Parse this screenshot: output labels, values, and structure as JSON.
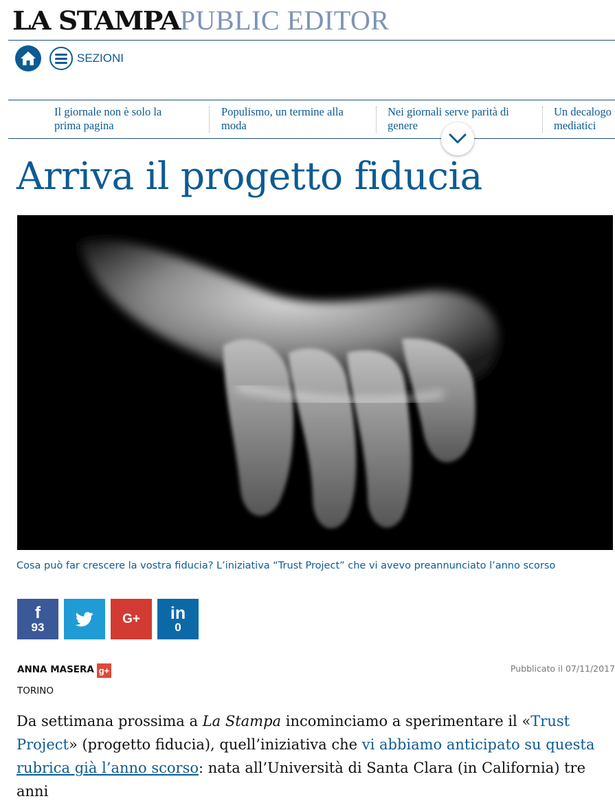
{
  "brand": {
    "logo": "LA STAMPA",
    "section": "PUBLIC EDITOR"
  },
  "nav": {
    "sections_label": "SEZIONI"
  },
  "related_articles": [
    {
      "line1": "Il giornale non è solo la",
      "line2": "prima pagina"
    },
    {
      "line1": "Populismo, un termine alla",
      "line2": "moda"
    },
    {
      "line1": "Nei giornali serve parità di",
      "line2": "genere"
    },
    {
      "line1": "Un decalogo",
      "line2": "mediatici"
    }
  ],
  "article": {
    "title": "Arriva il progetto fiducia",
    "image_caption": "Cosa può far crescere la vostra fiducia? L’iniziativa “Trust Project” che vi avevo preannunciato l’anno scorso",
    "author": "ANNA MASERA",
    "published": "Pubblicato il 07/11/2017",
    "location": "TORINO",
    "body": {
      "p1": "Da settimana prossima a ",
      "italic": "La Stampa",
      "p2": " incominciamo a sperimentare il «",
      "link1": "Trust Project",
      "p3": "» (progetto fiducia), quell’iniziativa che ",
      "link2a": "vi abbiamo anticipato su questa",
      "link2b": "rubrica già l’anno scorso",
      "p4": ": nata all’Università di Santa Clara (in California) tre anni"
    }
  },
  "share": {
    "facebook": {
      "glyph": "f",
      "count": "93"
    },
    "twitter": {
      "icon": "twitter-bird-icon"
    },
    "googleplus": {
      "glyph": "G+"
    },
    "linkedin": {
      "glyph": "in",
      "count": "0"
    }
  },
  "colors": {
    "brand_blue": "#0d5b93",
    "facebook": "#3b5998",
    "twitter": "#1f9bd6",
    "googleplus": "#d23b32",
    "linkedin": "#0c69a7"
  }
}
